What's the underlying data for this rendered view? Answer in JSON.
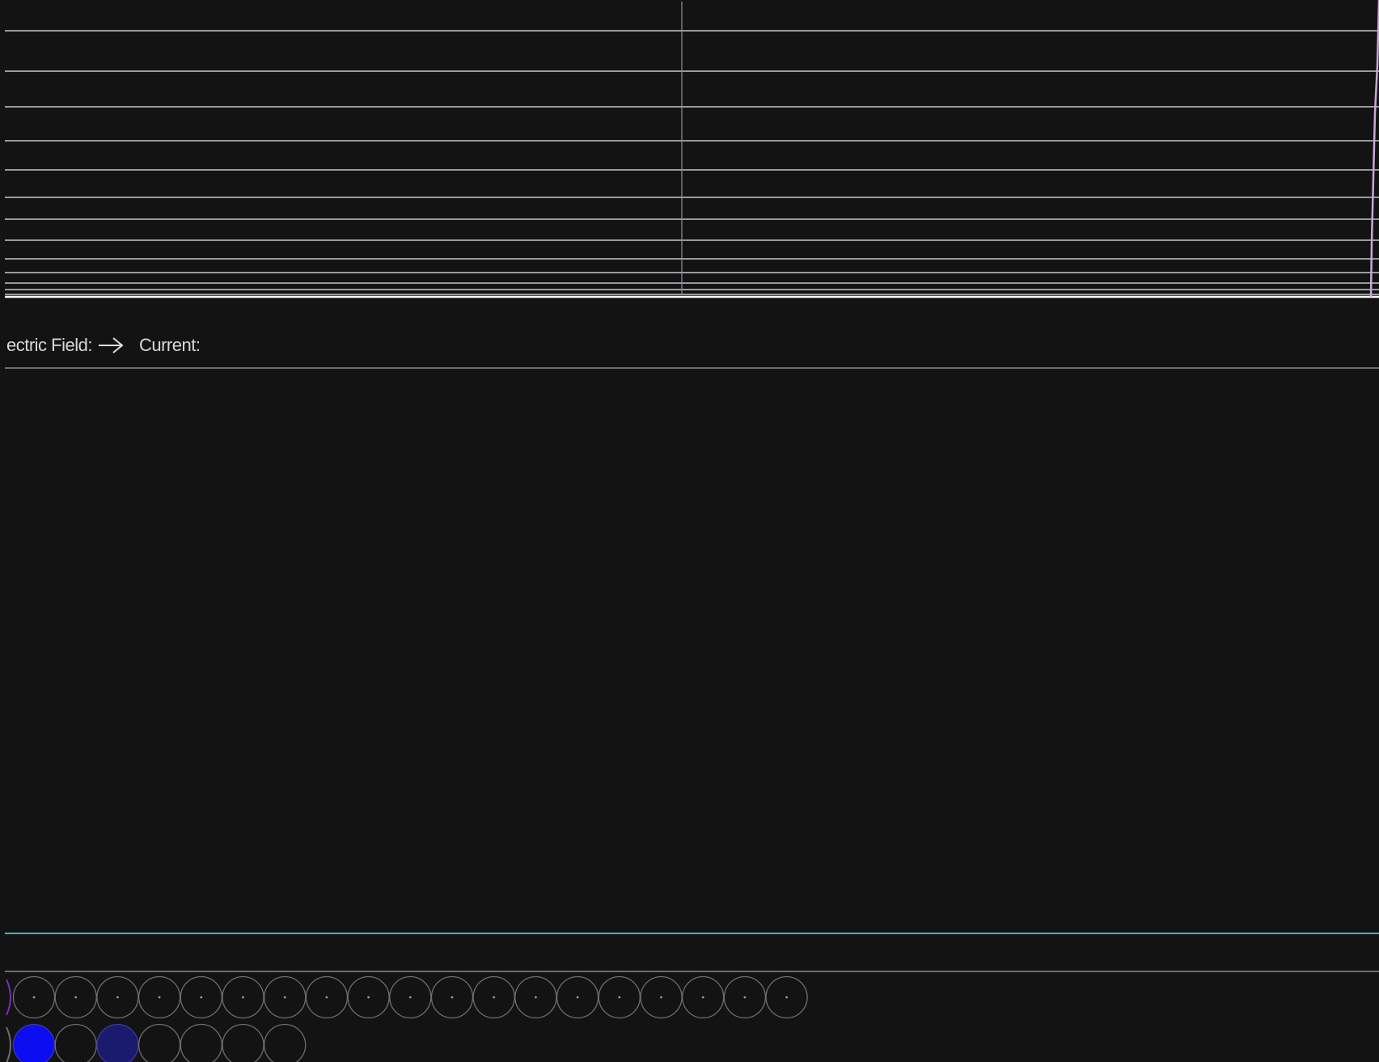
{
  "legend": {
    "electric_field_label": "ectric Field:",
    "field_arrow_icon": "arrow-right-icon",
    "current_label": "Current:"
  },
  "colors": {
    "background": "#131314",
    "line": "#c8c8cc",
    "wire_top": "#3fb8c0",
    "electron_fill": "#0d0df2",
    "electron_fill_dim": "#1a1a6e",
    "atom_outline": "#6e6e72",
    "edge_particle": "#7a2fb0"
  },
  "electrons": {
    "row1_count": 19,
    "row2_count": 7,
    "filled_row2_indexes": [
      0,
      2
    ]
  }
}
